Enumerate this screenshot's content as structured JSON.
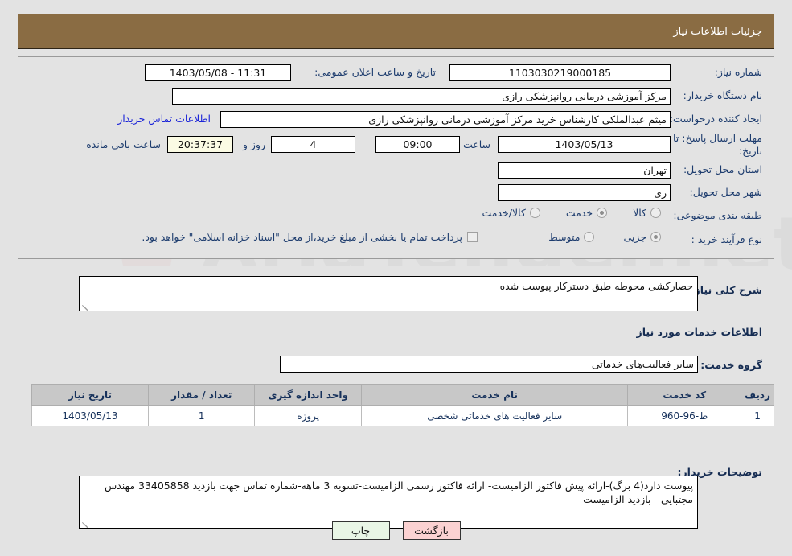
{
  "header": {
    "title": "جزئیات اطلاعات نیاز"
  },
  "form": {
    "need_number_label": "شماره نیاز:",
    "need_number_value": "1103030219000185",
    "announce_datetime_label": "تاریخ و ساعت اعلان عمومی:",
    "announce_datetime_value": "1403/05/08 - 11:31",
    "buyer_org_label": "نام دستگاه خریدار:",
    "buyer_org_value": "مرکز آموزشی درمانی روانپزشکی رازی",
    "requester_label": "ایجاد کننده درخواست:",
    "requester_value": "میثم عبدالملکی کارشناس خرید مرکز آموزشی درمانی روانپزشکی رازی",
    "buyer_org_extra_value": "مرکز آموزشی درمانی روانپزشکی رازی",
    "contact_link": "اطلاعات تماس خریدار",
    "deadline_label": "مهلت ارسال پاسخ: تا تاریخ:",
    "deadline_date": "1403/05/13",
    "hour_label": "ساعت",
    "hour_value": "09:00",
    "days_value": "4",
    "days_label": "روز و",
    "timer_value": "20:37:37",
    "remaining_label": "ساعت باقی مانده",
    "province_label": "استان محل تحویل:",
    "province_value": "تهران",
    "city_label": "شهر محل تحویل:",
    "city_value": "ری",
    "category_label": "طبقه بندی موضوعی:",
    "category_options": [
      {
        "label": "کالا",
        "selected": false
      },
      {
        "label": "خدمت",
        "selected": true
      },
      {
        "label": "کالا/خدمت",
        "selected": false
      }
    ],
    "process_label": "نوع فرآیند خرید :",
    "process_options": [
      {
        "label": "جزیی",
        "selected": true
      },
      {
        "label": "متوسط",
        "selected": false
      }
    ],
    "treasury_checkbox_label": "پرداخت تمام یا بخشی از مبلغ خرید،از محل \"اسناد خزانه اسلامی\" خواهد بود.",
    "treasury_checked": false
  },
  "details": {
    "general_desc_label": "شرح کلی نیاز:",
    "general_desc_value": "حصارکشی محوطه طبق دسترکار پیوست شده",
    "services_info_title": "اطلاعات خدمات مورد نیاز",
    "service_group_label": "گروه خدمت:",
    "service_group_value": "سایر فعالیت‌های خدماتی",
    "buyer_notes_label": "توضیحات خریدار:",
    "buyer_notes_value": "پیوست دارد(4 برگ)-ارائه پیش فاکتور الزامیست- ارائه فاکتور رسمی الزامیست-تسویه 3 ماهه-شماره تماس جهت بازدید 33405858 مهندس مجتبایی - بازدید الزامیست"
  },
  "table": {
    "headers": [
      "ردیف",
      "کد خدمت",
      "نام خدمت",
      "واحد اندازه گیری",
      "تعداد / مقدار",
      "تاریخ نیاز"
    ],
    "rows": [
      {
        "row": "1",
        "code": "ط-96-960",
        "name": "سایر فعالیت های خدماتی شخصی",
        "unit": "پروژه",
        "qty": "1",
        "date": "1403/05/13"
      }
    ]
  },
  "buttons": {
    "print": "چاپ",
    "back": "بازگشت"
  },
  "colors": {
    "header_bg": "#8a6c43",
    "page_bg": "#e3e3e3",
    "label_blue": "#1d3c6e",
    "link_blue": "#1b24d8",
    "timer_bg": "#fbfbe4",
    "table_header_bg": "#c8c8c8",
    "print_btn_bg": "#e9f6e6",
    "back_btn_bg": "#fbd2d2"
  }
}
